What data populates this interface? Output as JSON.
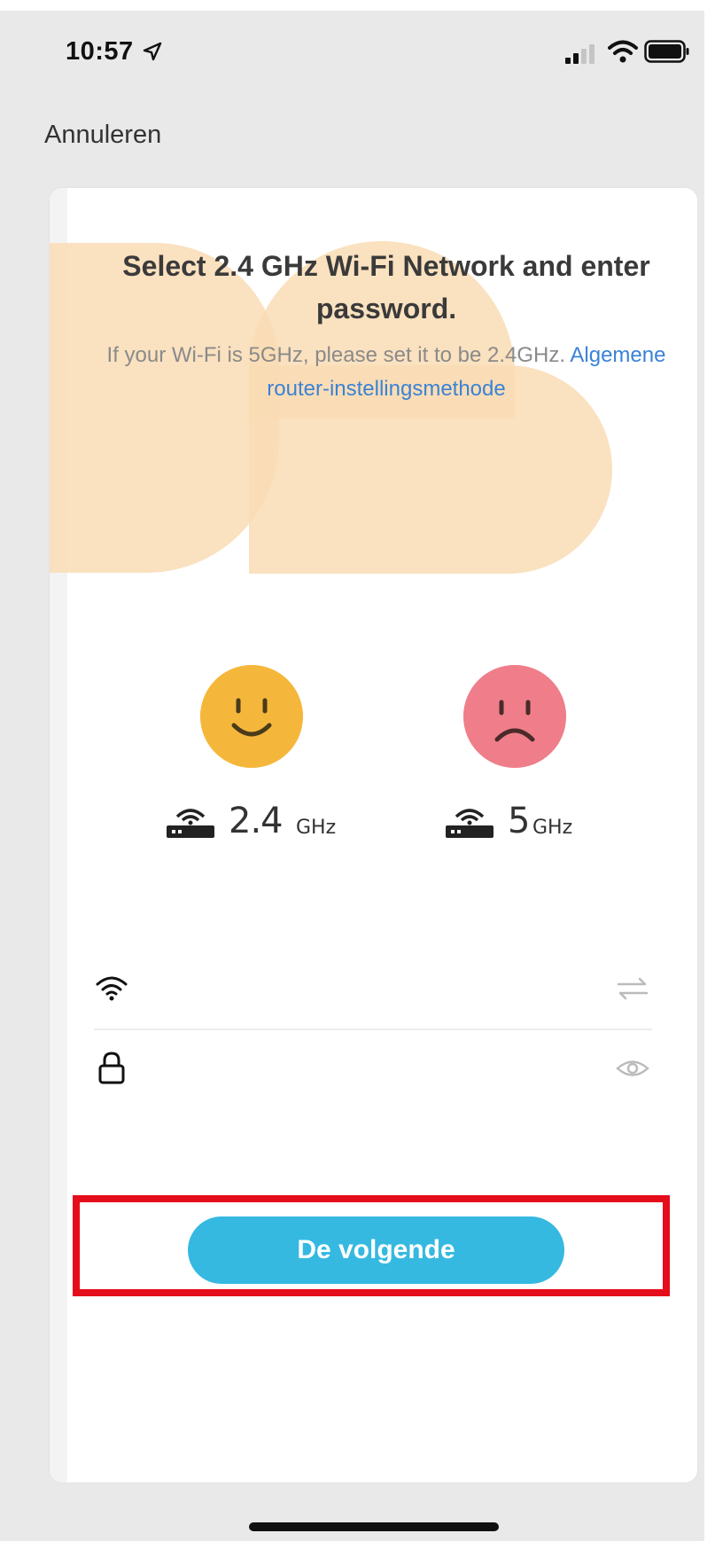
{
  "status_bar": {
    "time": "10:57"
  },
  "nav": {
    "cancel_label": "Annuleren"
  },
  "card": {
    "title": "Select 2.4 GHz Wi-Fi Network and enter password.",
    "subtitle_text": "If your Wi-Fi is 5GHz, please set it to be 2.4GHz.",
    "subtitle_link": "Algemene router-instellingsmethode",
    "bands": [
      {
        "number": "2.4",
        "unit": "GHz",
        "status": "supported"
      },
      {
        "number": "5",
        "unit": "GHz",
        "status": "unsupported"
      }
    ],
    "ssid_field": {
      "value": "",
      "placeholder": ""
    },
    "password_field": {
      "value": "",
      "placeholder": ""
    },
    "next_button_label": "De volgende"
  },
  "colors": {
    "accent": "#35b9e0",
    "link": "#3b82d6",
    "happy_face": "#f5b73b",
    "sad_face": "#ef7e8a",
    "highlight": "#e50d1b"
  },
  "icons": [
    "location-arrow-icon",
    "signal-icon",
    "wifi-icon",
    "battery-icon",
    "router-icon",
    "lock-icon",
    "switch-arrows-icon",
    "eye-icon"
  ]
}
